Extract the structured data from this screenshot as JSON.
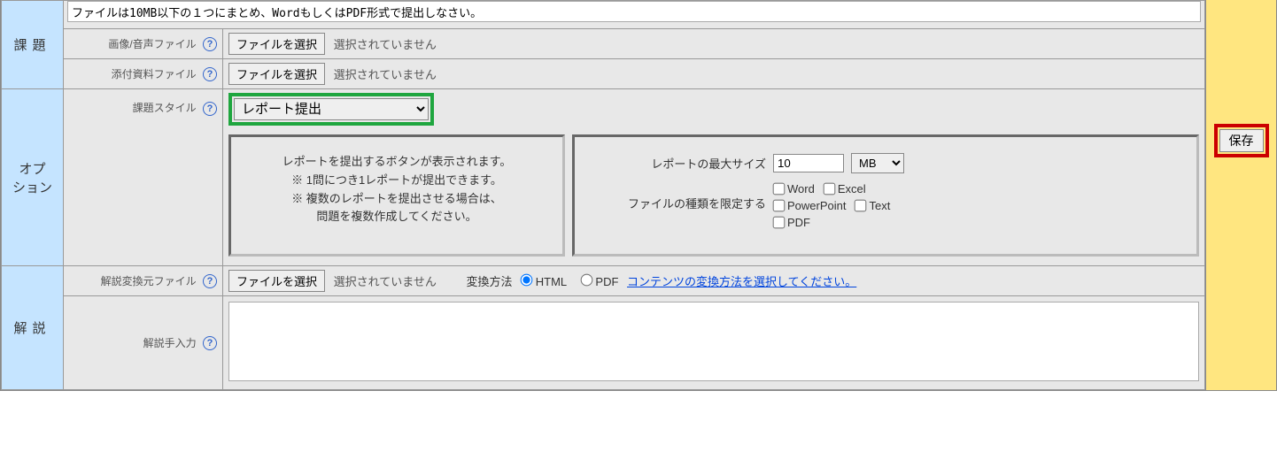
{
  "section": {
    "kadai_label": "課題",
    "option_label": "オプ\nション",
    "kaisetsu_label": "解説"
  },
  "kadai": {
    "textarea_value": "ファイルは10MB以下の１つにまとめ、WordもしくはPDF形式で提出しなさい。",
    "image_audio_label": "画像/音声ファイル",
    "attachment_label": "添付資料ファイル",
    "file_button": "ファイルを選択",
    "file_not_selected": "選択されていません"
  },
  "option": {
    "style_label": "課題スタイル",
    "style_value": "レポート提出",
    "panel_text_l1": "レポートを提出するボタンが表示されます。",
    "panel_text_l2": "※ 1問につき1レポートが提出できます。",
    "panel_text_l3": "※ 複数のレポートを提出させる場合は、",
    "panel_text_l4": "問題を複数作成してください。",
    "max_size_label": "レポートの最大サイズ",
    "max_size_value": "10",
    "max_size_unit": "MB",
    "limit_type_label": "ファイルの種類を限定する",
    "types": {
      "word": "Word",
      "excel": "Excel",
      "powerpoint": "PowerPoint",
      "text": "Text",
      "pdf": "PDF"
    }
  },
  "explain": {
    "source_file_label": "解説変換元ファイル",
    "method_label": "変換方法",
    "method_html": "HTML",
    "method_pdf": "PDF",
    "method_link": "コンテンツの変換方法を選択してください。",
    "manual_label": "解説手入力",
    "manual_value": ""
  },
  "side": {
    "save_label": "保存"
  }
}
